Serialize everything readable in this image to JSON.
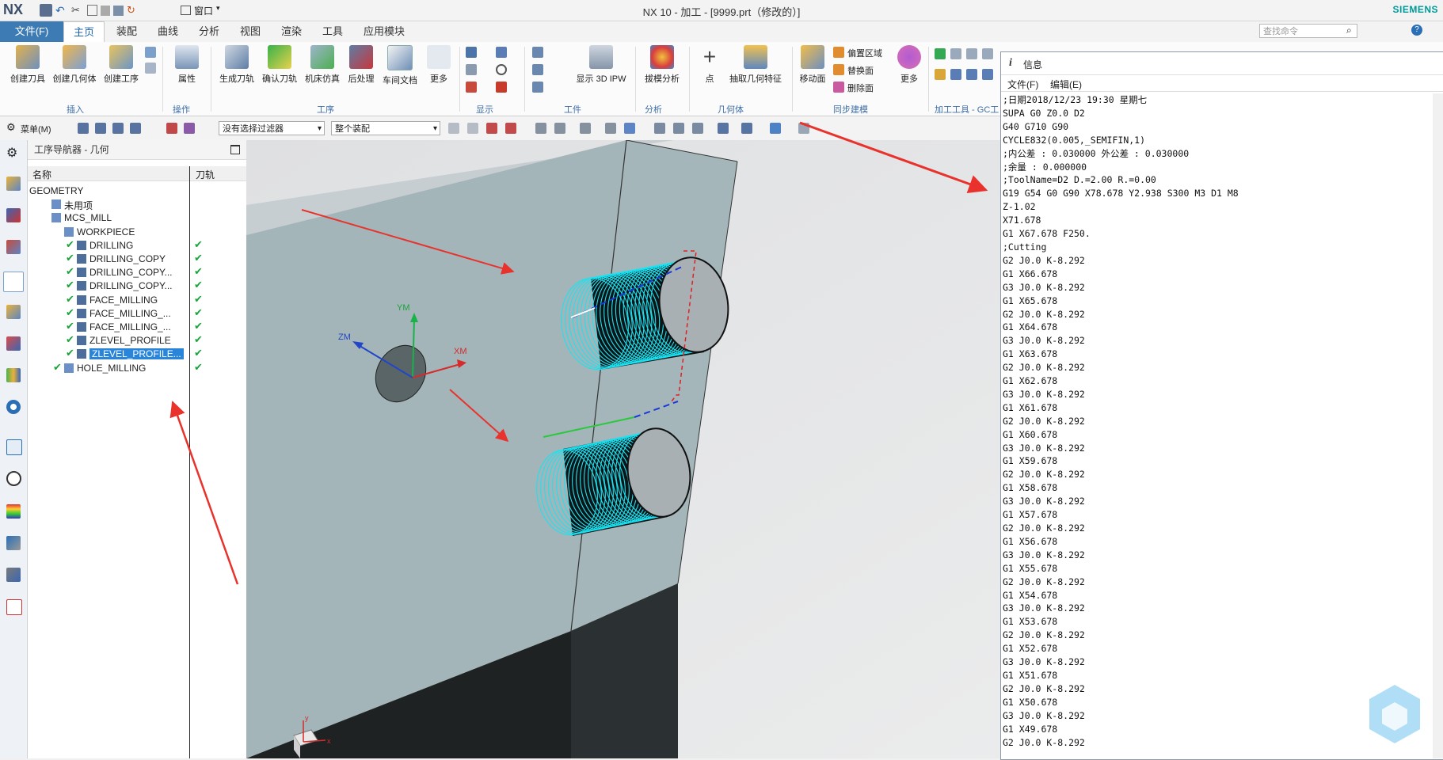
{
  "titlebar": {
    "logo": "NX",
    "window_menu": "窗口",
    "title": "NX 10 - 加工 - [9999.prt（修改的）]",
    "brand": "SIEMENS"
  },
  "menubar": {
    "file": "文件(F)",
    "tabs": [
      "主页",
      "装配",
      "曲线",
      "分析",
      "视图",
      "渲染",
      "工具",
      "应用模块"
    ],
    "active_tab": "主页",
    "search_placeholder": "查找命令"
  },
  "ribbon": {
    "buttons": [
      "创建刀具",
      "创建几何体",
      "创建工序",
      "属性",
      "生成刀轨",
      "确认刀轨",
      "机床仿真",
      "后处理",
      "车间文档",
      "更多",
      "显示 3D IPW",
      "拔模分析",
      "点",
      "抽取几何特征",
      "移动面",
      "更多"
    ],
    "sync_items": [
      "偏置区域",
      "替换面",
      "删除面"
    ],
    "groups": [
      "插入",
      "操作",
      "工序",
      "显示",
      "工件",
      "分析",
      "几何体",
      "同步建模",
      "加工工具 - GC工"
    ]
  },
  "toolbar2": {
    "menu": "菜单(M)",
    "filter": "没有选择过滤器",
    "scope": "整个装配"
  },
  "navigator": {
    "title": "工序导航器 - 几何",
    "col_name": "名称",
    "col_path": "刀轨",
    "rows": [
      {
        "label": "GEOMETRY",
        "indent": 0,
        "check": false,
        "path": false,
        "selected": false
      },
      {
        "label": "未用项",
        "indent": 1,
        "check": false,
        "path": false,
        "selected": false
      },
      {
        "label": "MCS_MILL",
        "indent": 1,
        "check": false,
        "path": false,
        "selected": false
      },
      {
        "label": "WORKPIECE",
        "indent": 2,
        "check": false,
        "path": false,
        "selected": false
      },
      {
        "label": "DRILLING",
        "indent": 3,
        "check": true,
        "path": true,
        "selected": false
      },
      {
        "label": "DRILLING_COPY",
        "indent": 3,
        "check": true,
        "path": true,
        "selected": false
      },
      {
        "label": "DRILLING_COPY...",
        "indent": 3,
        "check": true,
        "path": true,
        "selected": false
      },
      {
        "label": "DRILLING_COPY...",
        "indent": 3,
        "check": true,
        "path": true,
        "selected": false
      },
      {
        "label": "FACE_MILLING",
        "indent": 3,
        "check": true,
        "path": true,
        "selected": false
      },
      {
        "label": "FACE_MILLING_...",
        "indent": 3,
        "check": true,
        "path": true,
        "selected": false
      },
      {
        "label": "FACE_MILLING_...",
        "indent": 3,
        "check": true,
        "path": true,
        "selected": false
      },
      {
        "label": "ZLEVEL_PROFILE",
        "indent": 3,
        "check": true,
        "path": true,
        "selected": false
      },
      {
        "label": "ZLEVEL_PROFILE...",
        "indent": 3,
        "check": true,
        "path": true,
        "selected": true
      },
      {
        "label": "HOLE_MILLING",
        "indent": 2,
        "check": true,
        "path": true,
        "selected": false
      }
    ]
  },
  "viewport": {
    "axis_labels": {
      "ym": "YM",
      "zm": "ZM",
      "xm": "XM"
    },
    "triad": {
      "y": "y",
      "x": "x"
    }
  },
  "info": {
    "title": "信息",
    "menu": [
      "文件(F)",
      "编辑(E)"
    ],
    "lines": [
      ";日期2018/12/23 19:30 星期七",
      "SUPA G0 Z0.0 D2",
      "G40 G710 G90",
      "CYCLE832(0.005,_SEMIFIN,1)",
      ";内公差 : 0.030000 外公差 : 0.030000",
      ";余量 : 0.000000",
      ";ToolName=D2 D.=2.00 R.=0.00",
      "G19 G54 G0 G90 X78.678 Y2.938 S300 M3 D1 M8",
      "Z-1.02",
      "X71.678",
      "G1 X67.678 F250.",
      ";Cutting",
      "G2 J0.0 K-8.292",
      "G1 X66.678",
      "G3 J0.0 K-8.292",
      "G1 X65.678",
      "G2 J0.0 K-8.292",
      "G1 X64.678",
      "G3 J0.0 K-8.292",
      "G1 X63.678",
      "G2 J0.0 K-8.292",
      "G1 X62.678",
      "G3 J0.0 K-8.292",
      "G1 X61.678",
      "G2 J0.0 K-8.292",
      "G1 X60.678",
      "G3 J0.0 K-8.292",
      "G1 X59.678",
      "G2 J0.0 K-8.292",
      "G1 X58.678",
      "G3 J0.0 K-8.292",
      "G1 X57.678",
      "G2 J0.0 K-8.292",
      "G1 X56.678",
      "G3 J0.0 K-8.292",
      "G1 X55.678",
      "G2 J0.0 K-8.292",
      "G1 X54.678",
      "G3 J0.0 K-8.292",
      "G1 X53.678",
      "G2 J0.0 K-8.292",
      "G1 X52.678",
      "G3 J0.0 K-8.292",
      "G1 X51.678",
      "G2 J0.0 K-8.292",
      "G1 X50.678",
      "G3 J0.0 K-8.292",
      "G1 X49.678",
      "G2 J0.0 K-8.292"
    ]
  },
  "colors": {
    "accent": "#3d7bb5",
    "toolpath": "#19e3f2",
    "arrow": "#e8322b",
    "check": "#19a33a"
  }
}
